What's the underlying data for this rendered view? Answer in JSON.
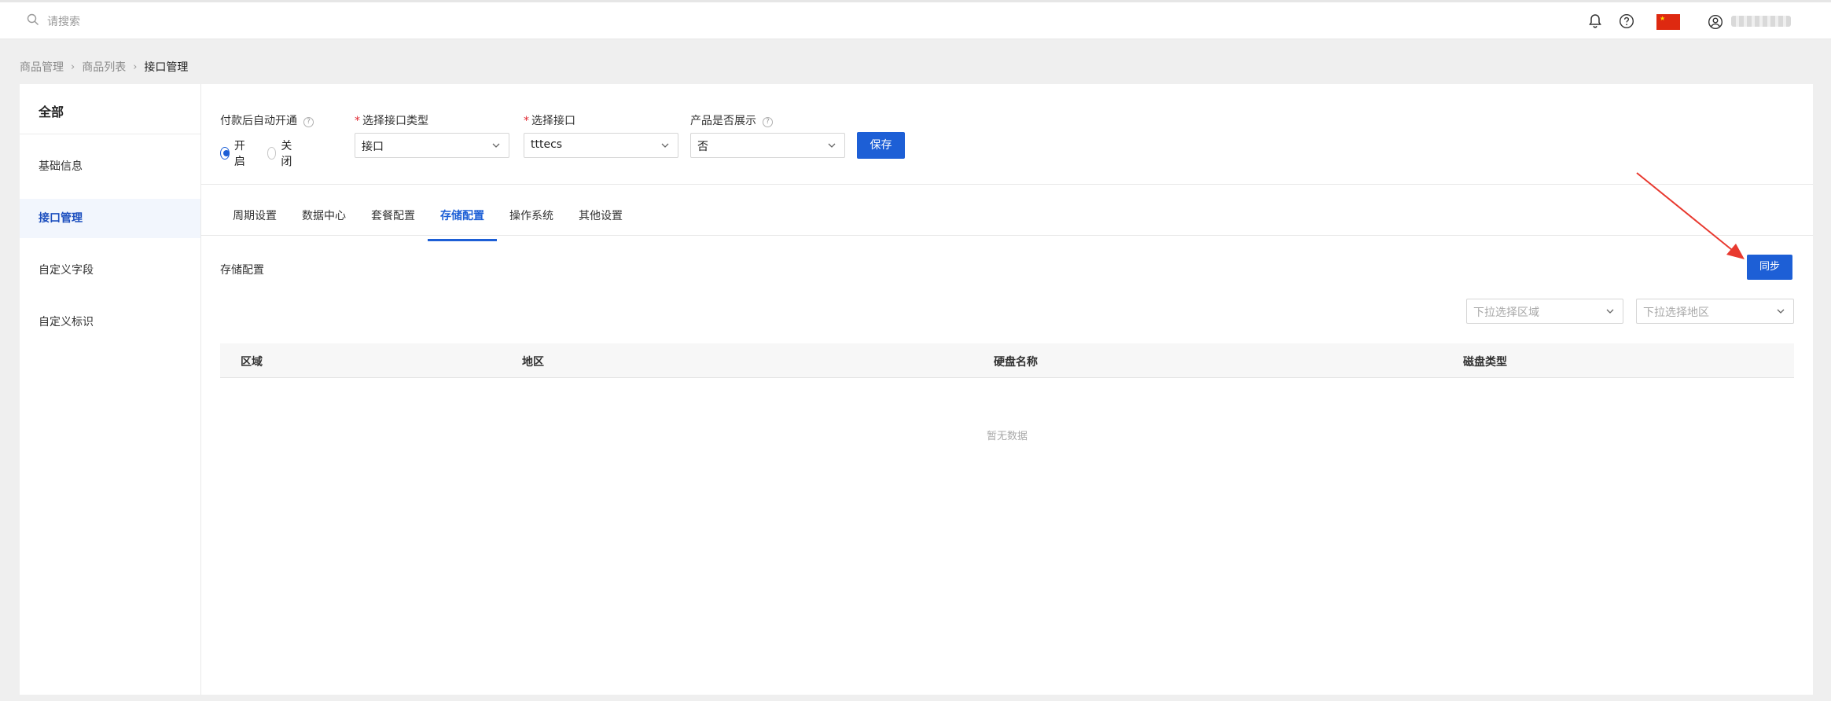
{
  "header": {
    "search_placeholder": "请搜索",
    "flag_symbol": "★",
    "icons": [
      "search-icon",
      "bell-icon",
      "help-icon",
      "china-flag-icon",
      "user-icon"
    ]
  },
  "breadcrumb": {
    "items": [
      "商品管理",
      "商品列表",
      "接口管理"
    ],
    "separator": "›"
  },
  "sidebar": {
    "title": "全部",
    "items": [
      {
        "label": "基础信息",
        "active": false
      },
      {
        "label": "接口管理",
        "active": true
      },
      {
        "label": "自定义字段",
        "active": false
      },
      {
        "label": "自定义标识",
        "active": false
      }
    ]
  },
  "form": {
    "auto_open": {
      "label": "付款后自动开通",
      "help": "?",
      "options": [
        "开启",
        "关闭"
      ],
      "selected": "开启"
    },
    "interface_type": {
      "required_mark": "*",
      "label": "选择接口类型",
      "value": "接口"
    },
    "interface": {
      "required_mark": "*",
      "label": "选择接口",
      "value": "tttecs"
    },
    "show_product": {
      "label": "产品是否展示",
      "help": "?",
      "value": "否"
    },
    "save_label": "保存"
  },
  "tabs": [
    {
      "label": "周期设置",
      "active": false
    },
    {
      "label": "数据中心",
      "active": false
    },
    {
      "label": "套餐配置",
      "active": false
    },
    {
      "label": "存储配置",
      "active": true
    },
    {
      "label": "操作系统",
      "active": false
    },
    {
      "label": "其他设置",
      "active": false
    }
  ],
  "storage": {
    "title": "存储配置",
    "sync_label": "同步",
    "area_placeholder": "下拉选择区域",
    "region_placeholder": "下拉选择地区",
    "columns": [
      "区域",
      "地区",
      "硬盘名称",
      "磁盘类型"
    ],
    "empty_text": "暂无数据"
  },
  "colors": {
    "primary": "#1d5fd6",
    "required": "#e0242e",
    "annotation_arrow": "#e8392f",
    "flag": "#de2910"
  }
}
